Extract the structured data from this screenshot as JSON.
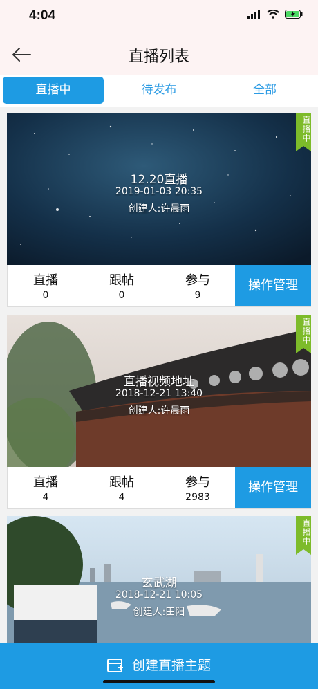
{
  "status": {
    "time": "4:04"
  },
  "nav": {
    "title": "直播列表"
  },
  "tabs": [
    {
      "label": "直播中"
    },
    {
      "label": "待发布"
    },
    {
      "label": "全部"
    }
  ],
  "live_tag": "直播中",
  "cards": [
    {
      "title": "12.20直播",
      "date": "2019-01-03 20:35",
      "creator": "创建人:许晨雨",
      "stats": [
        {
          "label": "直播",
          "value": "0"
        },
        {
          "label": "跟帖",
          "value": "0"
        },
        {
          "label": "参与",
          "value": "9"
        }
      ],
      "action": "操作管理"
    },
    {
      "title": "直播视频地址",
      "date": "2018-12-21 13:40",
      "creator": "创建人:许晨雨",
      "stats": [
        {
          "label": "直播",
          "value": "4"
        },
        {
          "label": "跟帖",
          "value": "4"
        },
        {
          "label": "参与",
          "value": "2983"
        }
      ],
      "action": "操作管理"
    },
    {
      "title": "玄武湖",
      "date": "2018-12-21 10:05",
      "creator": "创建人:田阳"
    }
  ],
  "bottom": {
    "create_label": "创建直播主题"
  },
  "colors": {
    "accent": "#1e9be3",
    "tag_green": "#7dbb2a"
  }
}
